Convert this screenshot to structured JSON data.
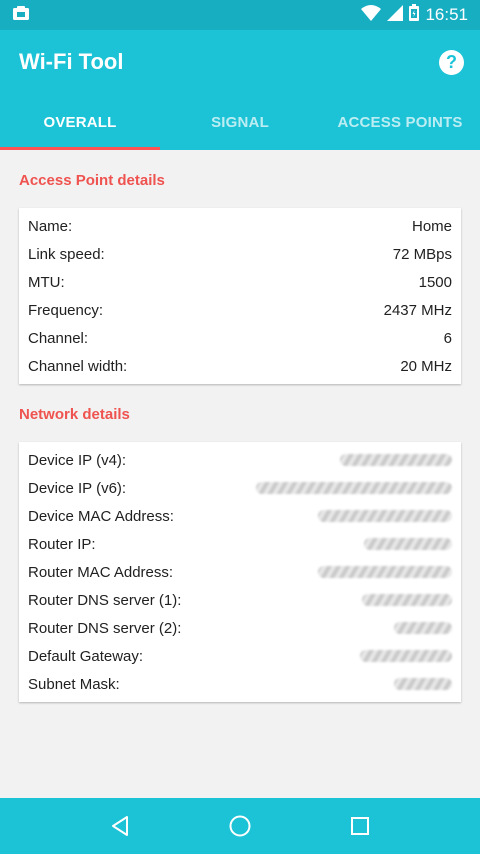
{
  "status_bar": {
    "time": "16:51",
    "icons": [
      "notification-icon",
      "wifi-icon",
      "signal-icon",
      "battery-icon"
    ]
  },
  "app_bar": {
    "title": "Wi-Fi Tool",
    "help_icon": "help-icon"
  },
  "tabs": [
    {
      "label": "OVERALL",
      "active": true
    },
    {
      "label": "SIGNAL",
      "active": false
    },
    {
      "label": "ACCESS POINTS",
      "active": false
    }
  ],
  "access_point": {
    "title": "Access Point details",
    "rows": [
      {
        "label": "Name:",
        "value": "Home"
      },
      {
        "label": "Link speed:",
        "value": "72 MBps"
      },
      {
        "label": "MTU:",
        "value": "1500"
      },
      {
        "label": "Frequency:",
        "value": "2437 MHz"
      },
      {
        "label": "Channel:",
        "value": "6"
      },
      {
        "label": "Channel width:",
        "value": "20 MHz"
      }
    ]
  },
  "network": {
    "title": "Network details",
    "rows": [
      {
        "label": "Device IP (v4):"
      },
      {
        "label": "Device IP (v6):"
      },
      {
        "label": "Device MAC Address:"
      },
      {
        "label": "Router IP:"
      },
      {
        "label": "Router MAC Address:"
      },
      {
        "label": "Router DNS server (1):"
      },
      {
        "label": "Router DNS server (2):"
      },
      {
        "label": "Default Gateway:"
      },
      {
        "label": "Subnet Mask:"
      }
    ]
  },
  "nav_bar": {
    "icons": [
      "back-icon",
      "home-icon",
      "recents-icon"
    ]
  },
  "colors": {
    "primary": "#1cc3d6",
    "status": "#17aec2",
    "accent": "#ef5350",
    "indicator": "#ff5252"
  }
}
